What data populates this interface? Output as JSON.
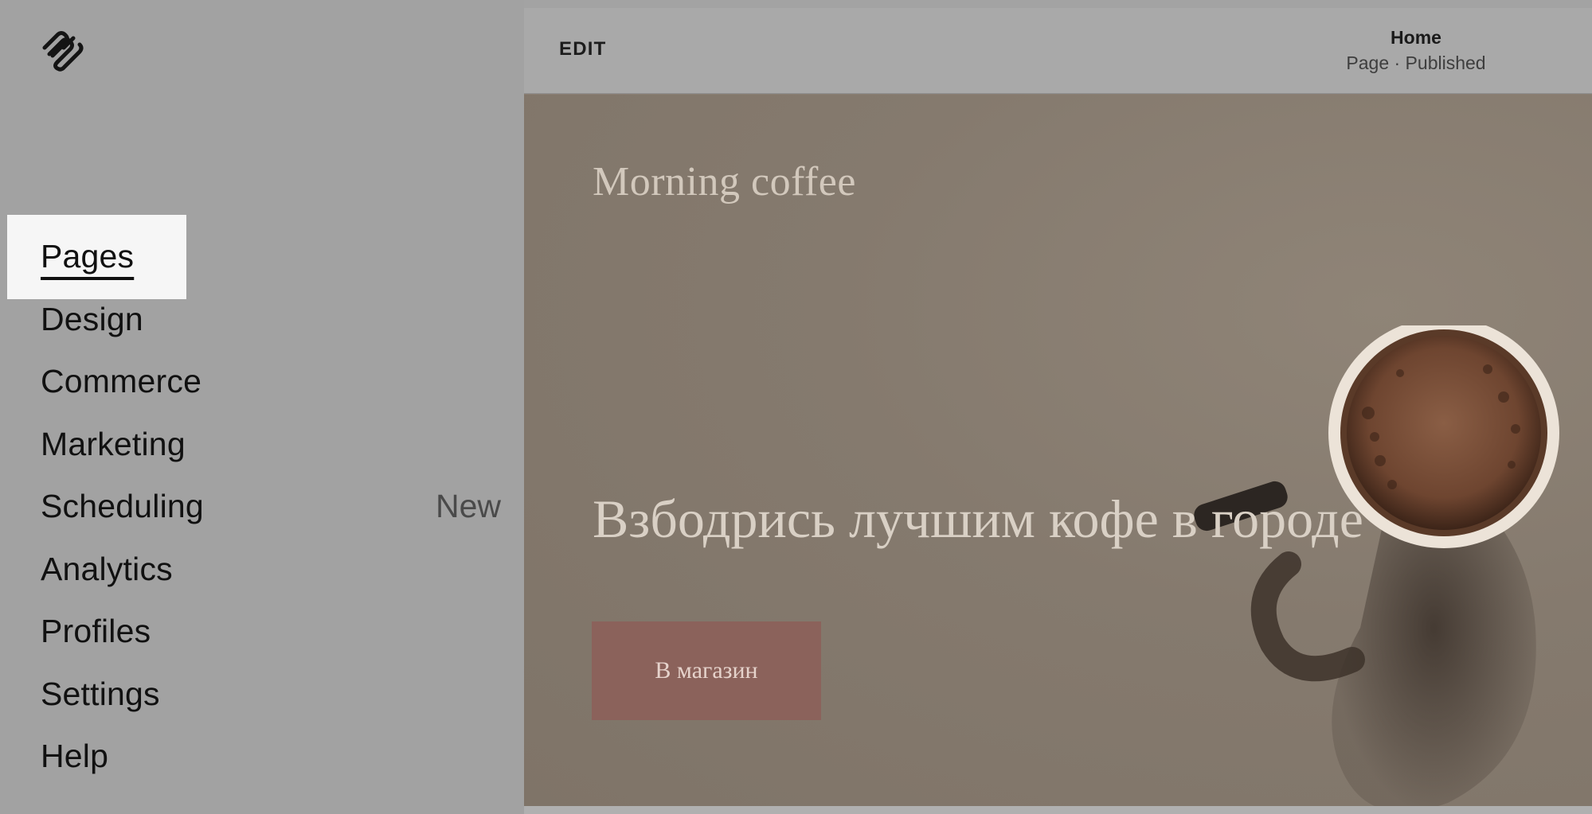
{
  "sidebar": {
    "logo_icon": "squarespace-logo-icon",
    "items": [
      {
        "label": "Pages",
        "badge": "",
        "active": true
      },
      {
        "label": "Design",
        "badge": ""
      },
      {
        "label": "Commerce",
        "badge": ""
      },
      {
        "label": "Marketing",
        "badge": ""
      },
      {
        "label": "Scheduling",
        "badge": "New"
      },
      {
        "label": "Analytics",
        "badge": ""
      },
      {
        "label": "Profiles",
        "badge": ""
      },
      {
        "label": "Settings",
        "badge": ""
      },
      {
        "label": "Help",
        "badge": ""
      }
    ]
  },
  "toolbar": {
    "edit_label": "EDIT",
    "page_title": "Home",
    "page_status": "Page · Published"
  },
  "site": {
    "brand": "Morning coffee",
    "headline": "Взбодрись лучшим кофе в городе",
    "cta_label": "В магазин"
  },
  "colors": {
    "sidebar_bg": "#a2a2a2",
    "active_item_bg": "#f6f6f6",
    "hero_bg": "#857a6e",
    "cta_bg": "#8b625b"
  }
}
